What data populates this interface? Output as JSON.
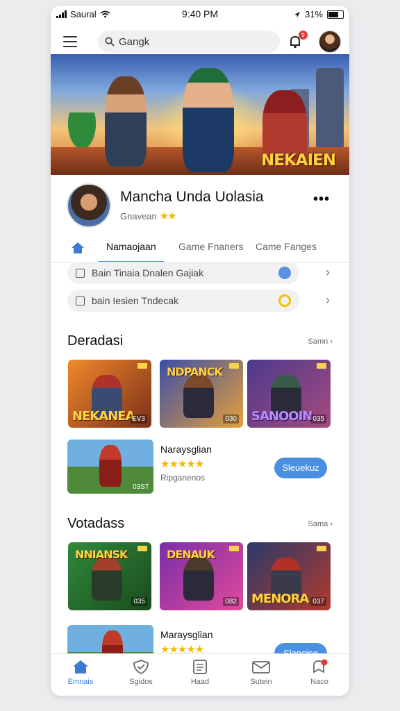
{
  "status_bar": {
    "carrier": "Saural",
    "time": "9:40 PM",
    "battery": "31%"
  },
  "header": {
    "search_value": "Gangk",
    "notification_count": "9"
  },
  "banner": {
    "title": "NEKAIEN"
  },
  "profile": {
    "name": "Mancha Unda Uolasia",
    "subtitle": "Gnavean",
    "stars": "★★"
  },
  "tabs": [
    "Namaojaan",
    "Game Fnaners",
    "Came Fanges"
  ],
  "list_rows": [
    {
      "label": "Bain Tinaia Dnalen Gajiak",
      "status_color": "#5b8fe0"
    },
    {
      "label": "bain Iesien Tndecak",
      "status_color": "#f2c200"
    }
  ],
  "sections": [
    {
      "title": "Deradasi",
      "see_all": "Samn ›",
      "thumbs": [
        {
          "title": "NEKANEA",
          "num": "EV3",
          "colors": [
            "#f08a2c",
            "#7c2f1a"
          ]
        },
        {
          "title": "NDPANCK",
          "num": "030",
          "colors": [
            "#3a4ea8",
            "#e6a03a"
          ]
        },
        {
          "title": "SANOOIN",
          "num": "035",
          "colors": [
            "#4b3a8c",
            "#a64a7e"
          ]
        }
      ],
      "featured": {
        "name": "Naraysglian",
        "rating": "★★★★★",
        "meta": "Ripganenos",
        "button": "Sleuekuz",
        "num": "03ST"
      }
    },
    {
      "title": "Votadass",
      "see_all": "Sama ›",
      "thumbs": [
        {
          "title": "NNIANSK",
          "num": "035",
          "colors": [
            "#2f8a3c",
            "#1b4a1d"
          ]
        },
        {
          "title": "DENAUK",
          "num": "082",
          "colors": [
            "#7a2fa8",
            "#e04a9a"
          ]
        },
        {
          "title": "MENORA",
          "num": "037",
          "colors": [
            "#2a3a6a",
            "#b03a2e"
          ]
        }
      ],
      "featured": {
        "name": "Maraysglian",
        "rating": "★★★★★",
        "meta": "",
        "button": "Slancipe",
        "num": ""
      }
    }
  ],
  "bottom_nav": [
    {
      "label": "Emnais",
      "icon": "home-icon"
    },
    {
      "label": "Sgidos",
      "icon": "shield-icon"
    },
    {
      "label": "Haad",
      "icon": "document-icon"
    },
    {
      "label": "Sutein",
      "icon": "mail-icon"
    },
    {
      "label": "Naco",
      "icon": "user-alert-icon"
    }
  ]
}
